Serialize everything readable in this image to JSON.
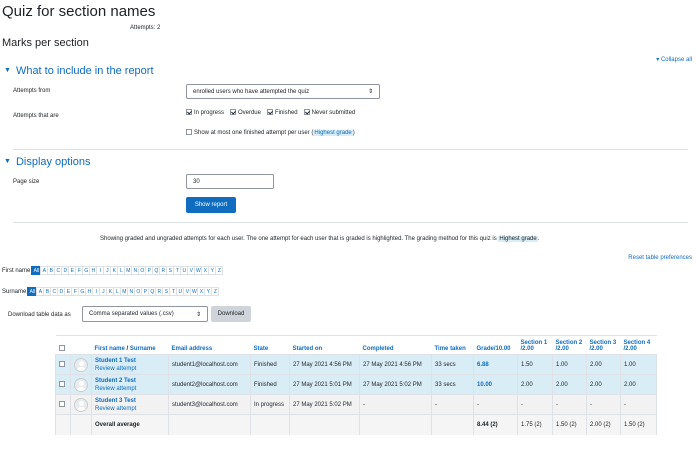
{
  "page": {
    "title": "Quiz for section names",
    "attempts": "Attempts: 2",
    "subtitle": "Marks per section",
    "collapse_all": "Collapse all"
  },
  "include": {
    "heading": "What to include in the report",
    "attempts_from_label": "Attempts from",
    "attempts_from_value": "enrolled users who have attempted the quiz",
    "attempts_that_are_label": "Attempts that are",
    "states": [
      {
        "label": "In progress",
        "checked": true
      },
      {
        "label": "Overdue",
        "checked": true
      },
      {
        "label": "Finished",
        "checked": true
      },
      {
        "label": "Never submitted",
        "checked": true
      }
    ],
    "show_one_prefix": "Show at most one finished attempt per user (",
    "show_one_link": "Highest grade",
    "show_one_suffix": ")"
  },
  "display": {
    "heading": "Display options",
    "page_size_label": "Page size",
    "page_size_value": "30",
    "show_report": "Show report"
  },
  "info": {
    "text": "Showing graded and ungraded attempts for each user. The one attempt for each user that is graded is highlighted. The grading method for this quiz is",
    "method": "Highest grade",
    "end": ".",
    "reset": "Reset table preferences"
  },
  "initials": {
    "first_label": "First name",
    "surname_label": "Surname",
    "all": "All",
    "letters": [
      "A",
      "B",
      "C",
      "D",
      "E",
      "F",
      "G",
      "H",
      "I",
      "J",
      "K",
      "L",
      "M",
      "N",
      "O",
      "P",
      "Q",
      "R",
      "S",
      "T",
      "U",
      "V",
      "W",
      "X",
      "Y",
      "Z"
    ]
  },
  "download": {
    "label": "Download table data as",
    "format": "Comma separated values (.csv)",
    "button": "Download"
  },
  "table": {
    "headers": {
      "name_a": "First name",
      "name_sep": " / ",
      "name_b": "Surname",
      "email": "Email address",
      "state": "State",
      "started": "Started on",
      "completed": "Completed",
      "time": "Time taken",
      "grade": "Grade/10.00",
      "s1a": "Section 1",
      "s1b": "/2.00",
      "s2a": "Section 2",
      "s2b": "/2.00",
      "s3a": "Section 3",
      "s3b": "/2.00",
      "s4a": "Section 4",
      "s4b": "/2.00"
    },
    "rows": [
      {
        "name": "Student 1 Test",
        "review": "Review attempt",
        "email": "student1@localhost.com",
        "state": "Finished",
        "started": "27 May 2021 4:56 PM",
        "completed": "27 May 2021 4:56 PM",
        "time": "33 secs",
        "grade": "6.88",
        "s1": "1.50",
        "s2": "1.00",
        "s3": "2.00",
        "s4": "1.00"
      },
      {
        "name": "Student 2 Test",
        "review": "Review attempt",
        "email": "student2@localhost.com",
        "state": "Finished",
        "started": "27 May 2021 5:01 PM",
        "completed": "27 May 2021 5:02 PM",
        "time": "33 secs",
        "grade": "10.00",
        "s1": "2.00",
        "s2": "2.00",
        "s3": "2.00",
        "s4": "2.00"
      },
      {
        "name": "Student 3 Test",
        "review": "Review attempt",
        "email": "student3@localhost.com",
        "state": "In progress",
        "started": "27 May 2021 5:02 PM",
        "completed": "-",
        "time": "-",
        "grade": "-",
        "s1": "-",
        "s2": "-",
        "s3": "-",
        "s4": "-"
      }
    ],
    "average": {
      "label": "Overall average",
      "grade": "8.44 (2)",
      "s1": "1.75 (2)",
      "s2": "1.50 (2)",
      "s3": "2.00 (2)",
      "s4": "1.50 (2)"
    }
  }
}
